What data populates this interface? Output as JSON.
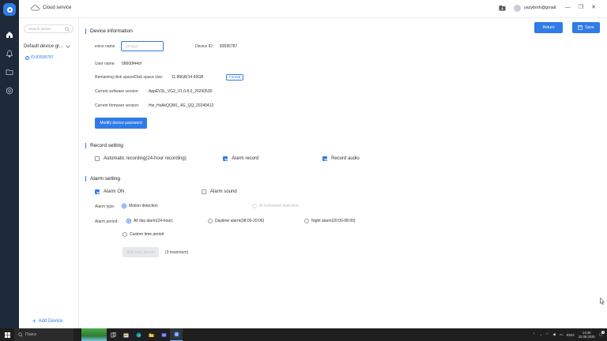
{
  "app": {
    "title": "Cloud service",
    "user": "yazybinh@gmail.",
    "window_controls": [
      "—",
      "❐",
      "✕"
    ]
  },
  "nav": {
    "items": [
      "home-icon",
      "bell-icon",
      "folder-icon",
      "record-icon"
    ]
  },
  "devices": {
    "search_placeholder": "Search device",
    "group_name": "Default device gr...",
    "device_id": "ID:83595787",
    "add_label": "Add Device"
  },
  "toolbar": {
    "return_label": "Return",
    "save_label": "Save"
  },
  "device_info": {
    "title": "Device information",
    "name_label": "evice name",
    "name_placeholder": "(empty)",
    "id_label": "Device ID:",
    "id_value": "83595787",
    "user_label": "User name:",
    "user_value": "58600f44of",
    "disk_label": "Remaining disk space/Disk space size:",
    "disk_value": "11.89GB/14.83GB",
    "format_label": "Format",
    "software_label": "Current software version:",
    "software_value": "AppEV3L_VG2_V1.0.8.0_20250530",
    "firmware_label": "Current firmware version:",
    "firmware_value": "Hw_HsAkQQWL_4G_QQ_20240412",
    "modify_password_label": "Modify device password"
  },
  "record_setting": {
    "title": "Record setting",
    "options": [
      {
        "label": "Automatic recording(24-hour recording)",
        "checked": false
      },
      {
        "label": "Alarm record",
        "checked": true
      },
      {
        "label": "Record audio",
        "checked": true
      }
    ]
  },
  "alarm_setting": {
    "title": "Alarm setting",
    "alarm_on_label": "Alarm ON",
    "alarm_on_checked": true,
    "alarm_sound_label": "Alarm sound",
    "alarm_sound_checked": false,
    "type_label": "Alarm type:",
    "type_options": [
      {
        "label": "Motion detection",
        "selected": true,
        "enabled": true
      },
      {
        "label": "AI humanoid detection",
        "selected": false,
        "enabled": false
      }
    ],
    "period_label": "Alarm period:",
    "period_options": [
      {
        "label": "All day alarm(24-hour)",
        "selected": true
      },
      {
        "label": "Daytime alarm(08:00-20:00)",
        "selected": false
      },
      {
        "label": "Night alarm(20:00-08:00)",
        "selected": false
      },
      {
        "label": "Custom time period",
        "selected": false
      }
    ],
    "add_period_label": "Add time period",
    "max_note": "(3 maximum)"
  },
  "taskbar": {
    "search_text": "Поиск",
    "lang": "ENG",
    "time": "14:25",
    "date": "22.06.2025",
    "notification_count": "3"
  },
  "colors": {
    "accent": "#2f7be8",
    "rail": "#1e2a3a",
    "taskbar": "#1f1f1f"
  }
}
